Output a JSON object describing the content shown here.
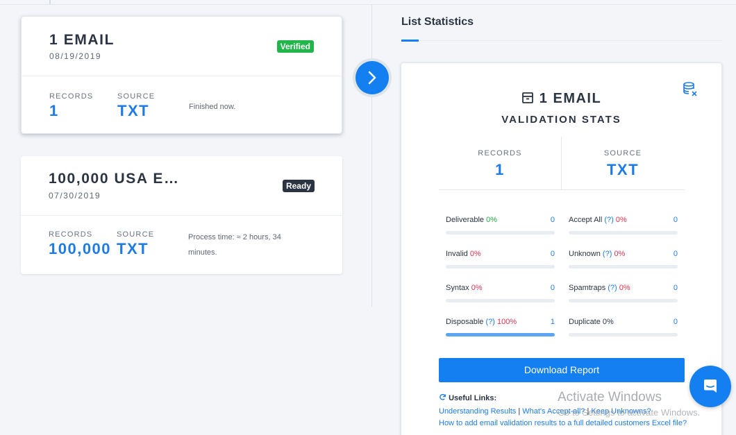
{
  "lists": [
    {
      "title": "1 EMAIL",
      "date": "08/19/2019",
      "badge": "Verified",
      "records_label": "RECORDS",
      "records": "1",
      "source_label": "SOURCE",
      "source": "TXT",
      "status": "Finished now."
    },
    {
      "title": "100,000 USA E…",
      "date": "07/30/2019",
      "badge": "Ready",
      "records_label": "RECORDS",
      "records": "100,000",
      "source_label": "SOURCE",
      "source": "TXT",
      "status": "Process time: ≈ 2 hours, 34 minutes."
    }
  ],
  "panel": {
    "title": "List Statistics",
    "stats_title": "1 EMAIL",
    "stats_subtitle": "VALIDATION STATS",
    "records_label": "RECORDS",
    "records": "1",
    "source_label": "SOURCE",
    "source": "TXT",
    "stats": [
      {
        "name": "Deliverable",
        "help": "",
        "pct": "0%",
        "pct_color": "green",
        "count": "0",
        "fill": 0
      },
      {
        "name": "Accept All",
        "help": "(?)",
        "pct": "0%",
        "pct_color": "red",
        "count": "0",
        "fill": 0
      },
      {
        "name": "Invalid",
        "help": "",
        "pct": "0%",
        "pct_color": "red",
        "count": "0",
        "fill": 0
      },
      {
        "name": "Unknown",
        "help": "(?)",
        "pct": "0%",
        "pct_color": "red",
        "count": "0",
        "fill": 0
      },
      {
        "name": "Syntax",
        "help": "",
        "pct": "0%",
        "pct_color": "red",
        "count": "0",
        "fill": 0
      },
      {
        "name": "Spamtraps",
        "help": "(?)",
        "pct": "0%",
        "pct_color": "red",
        "count": "0",
        "fill": 0
      },
      {
        "name": "Disposable",
        "help": "(?)",
        "pct": "100%",
        "pct_color": "red",
        "count": "1",
        "fill": 1
      },
      {
        "name": "Duplicate",
        "help": "",
        "pct": "0%",
        "pct_color": "none",
        "count": "0",
        "fill": 0
      }
    ],
    "download_label": "Download Report",
    "useful_links_label": "Useful Links:",
    "links": [
      "Understanding Results",
      "What's Accept-all?",
      "Keep Unknowns?",
      "How to add email validation results to a full detailed customers Excel file?"
    ]
  },
  "watermark": {
    "line1": "Activate Windows",
    "line2": "Go to Settings to activate Windows."
  },
  "colors": {
    "accent": "#137ff0",
    "verified": "#22b54a",
    "danger": "#e0314b"
  },
  "icons": [
    "chevron-right-icon",
    "archive-icon",
    "database-remove-icon",
    "refresh-icon",
    "chat-icon"
  ]
}
